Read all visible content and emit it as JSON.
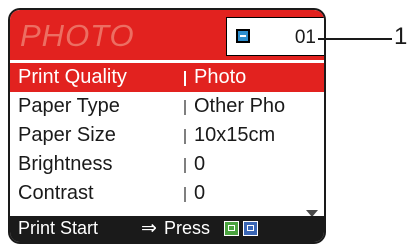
{
  "screen": {
    "title": "PHOTO",
    "ink_icon": "ink-cartridge-icon",
    "counter": "01"
  },
  "menu": [
    {
      "label": "Print Quality",
      "value": "Photo",
      "selected": true
    },
    {
      "label": "Paper Type",
      "value": "Other Pho",
      "selected": false
    },
    {
      "label": "Paper Size",
      "value": "10x15cm",
      "selected": false
    },
    {
      "label": "Brightness",
      "value": "0",
      "selected": false
    },
    {
      "label": "Contrast",
      "value": "0",
      "selected": false
    }
  ],
  "footer": {
    "text": "Print Start",
    "arrow": "⇒",
    "press": "Press",
    "buttons": [
      {
        "icon": "mono-start-icon",
        "color": "#4aa23f"
      },
      {
        "icon": "colour-start-icon",
        "color": "#3a66b5"
      }
    ]
  },
  "callout": {
    "label": "1"
  },
  "colors": {
    "accent": "#e2221f",
    "footer": "#1a1a1a"
  }
}
